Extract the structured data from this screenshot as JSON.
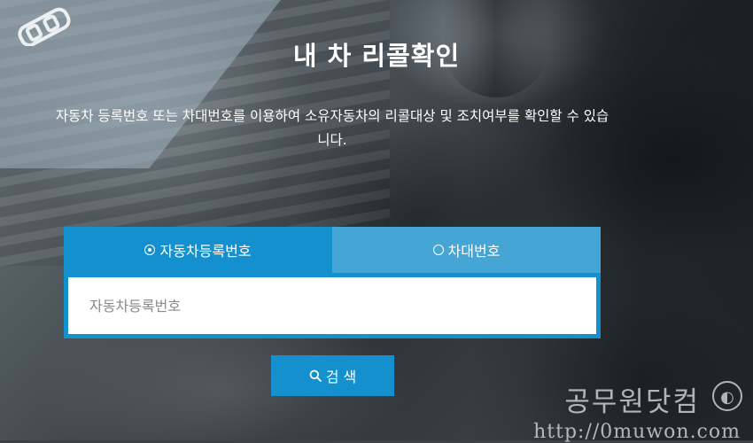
{
  "page": {
    "title": "내 차 리콜확인",
    "description": "자동차 등록번호 또는 차대번호를 이용하여 소유자동차의 리콜대상 및 조치여부를 확인할 수 있습니다."
  },
  "tabs": [
    {
      "label": "자동차등록번호",
      "selected": true
    },
    {
      "label": "차대번호",
      "selected": false
    }
  ],
  "search": {
    "placeholder": "자동차등록번호",
    "value": "",
    "button_label": "검 색"
  },
  "watermark": {
    "line1": "공무원닷컴",
    "line2": "http://0muwon.com"
  },
  "colors": {
    "accent": "#1590cf",
    "tab_inactive": "#45a6d6"
  },
  "icons": {
    "search": "search-icon",
    "radio_selected": "radio-selected-icon",
    "radio_unselected": "radio-unselected-icon",
    "car_logo": "car-logo-icon"
  }
}
